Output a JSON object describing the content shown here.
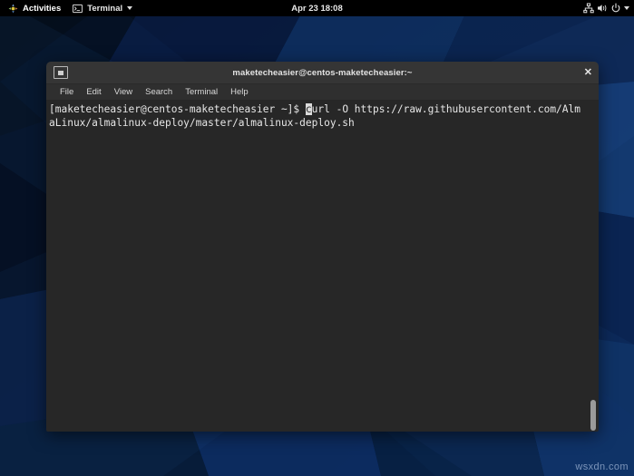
{
  "desktop": {
    "wallpaper_colors": {
      "base": "#0a1c44",
      "dark": "#050d22",
      "mid": "#123066",
      "light": "#1d4a8f",
      "highlight": "#2a5fa8"
    },
    "watermark": "wsxdn.com"
  },
  "topbar": {
    "background": "#000000",
    "activities": {
      "label": "Activities",
      "icon": "distro-logo-icon"
    },
    "app_menu": {
      "label": "Terminal",
      "icon": "terminal-icon",
      "caret": "chevron-down-icon"
    },
    "clock": "Apr 23  18:08",
    "status_icons": [
      {
        "name": "network-wired-icon"
      },
      {
        "name": "volume-icon"
      },
      {
        "name": "power-icon"
      },
      {
        "name": "chevron-down-icon"
      }
    ]
  },
  "terminal": {
    "title": "maketecheasier@centos-maketecheasier:~",
    "window_icon": "terminal-icon",
    "close_label": "✕",
    "menu": [
      {
        "label": "File"
      },
      {
        "label": "Edit"
      },
      {
        "label": "View"
      },
      {
        "label": "Search"
      },
      {
        "label": "Terminal"
      },
      {
        "label": "Help"
      }
    ],
    "colors": {
      "titlebar": "#353535",
      "menubar": "#2f2f2f",
      "body": "#272727",
      "text": "#e6e6e6"
    },
    "content": {
      "prompt": "[maketecheasier@centos-maketecheasier ~]$ ",
      "cursor_char": "c",
      "command_after_cursor": "url -O https://raw.githubusercontent.com/AlmaLinux/almalinux-deploy/master/almalinux-deploy.sh"
    },
    "scrollbar": {
      "position": "bottom"
    }
  }
}
